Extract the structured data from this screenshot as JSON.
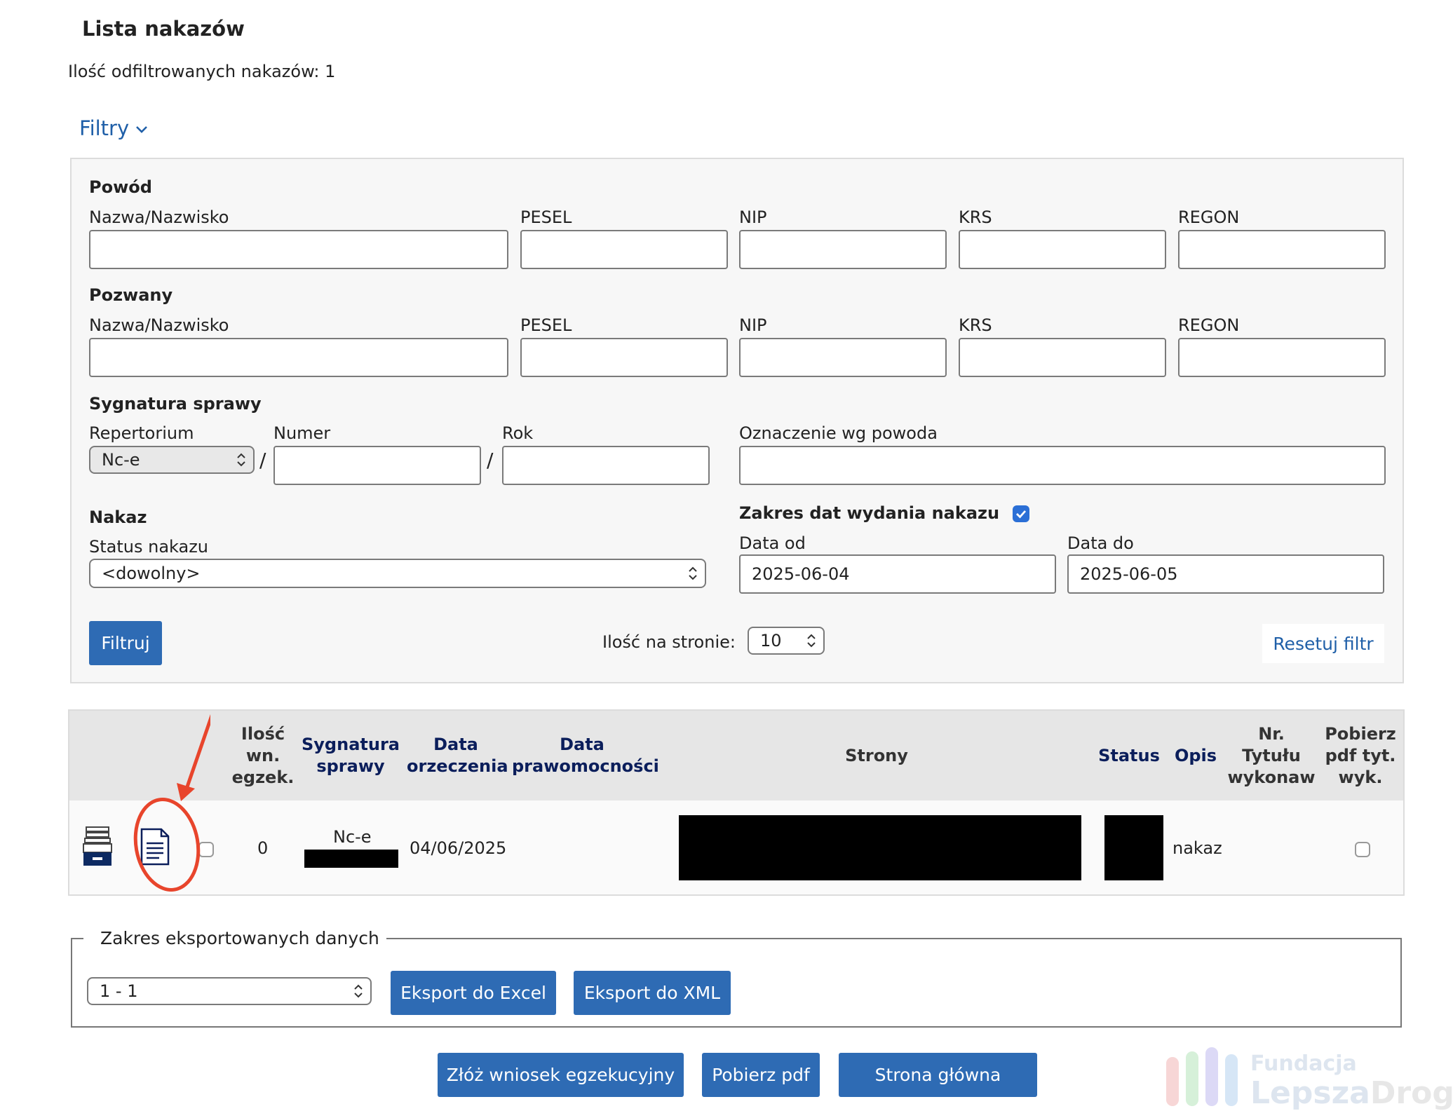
{
  "page": {
    "title": "Lista nakazów",
    "filtered_count": "Ilość odfiltrowanych nakazów: 1",
    "filters_toggle": "Filtry"
  },
  "filters": {
    "plaintiff": {
      "heading": "Powód",
      "labels": {
        "name": "Nazwa/Nazwisko",
        "pesel": "PESEL",
        "nip": "NIP",
        "krs": "KRS",
        "regon": "REGON"
      },
      "values": {
        "name": "",
        "pesel": "",
        "nip": "",
        "krs": "",
        "regon": ""
      }
    },
    "defendant": {
      "heading": "Pozwany",
      "labels": {
        "name": "Nazwa/Nazwisko",
        "pesel": "PESEL",
        "nip": "NIP",
        "krs": "KRS",
        "regon": "REGON"
      },
      "values": {
        "name": "",
        "pesel": "",
        "nip": "",
        "krs": "",
        "regon": ""
      }
    },
    "case_signature": {
      "heading": "Sygnatura sprawy",
      "repertorium_label": "Repertorium",
      "repertorium_value": "Nc-e",
      "number_label": "Numer",
      "number_value": "",
      "year_label": "Rok",
      "year_value": "",
      "separator": "/",
      "plaintiff_mark_label": "Oznaczenie wg powoda",
      "plaintiff_mark_value": ""
    },
    "order": {
      "heading": "Nakaz",
      "status_label": "Status nakazu",
      "status_value": "<dowolny>"
    },
    "date_range": {
      "heading": "Zakres dat wydania nakazu",
      "enabled": true,
      "from_label": "Data od",
      "from_value": "2025-06-04",
      "to_label": "Data do",
      "to_value": "2025-06-05"
    },
    "filter_button": "Filtruj",
    "per_page_label": "Ilość na stronie:",
    "per_page_value": "10",
    "reset_link": "Resetuj filtr"
  },
  "table": {
    "headers": {
      "enforcement_count": [
        "Ilość",
        "wn.",
        "egzek."
      ],
      "signature": [
        "Sygnatura",
        "sprawy"
      ],
      "ruling_date": [
        "Data",
        "orzeczenia"
      ],
      "finality_date": [
        "Data",
        "prawomocności"
      ],
      "parties": "Strony",
      "status": "Status",
      "description": "Opis",
      "title_number": [
        "Nr.",
        "Tytułu",
        "wykonaw"
      ],
      "download_pdf": [
        "Pobierz",
        "pdf tyt.",
        "wyk."
      ]
    },
    "rows": [
      {
        "enforcement_count": "0",
        "signature_prefix": "Nc-e",
        "ruling_date": "04/06/2025",
        "finality_date": "",
        "description": "nakaz",
        "title_number": ""
      }
    ],
    "icons": {
      "archive": "archive-cabinet-icon",
      "document": "document-icon"
    },
    "annotation_color": "#e8452c"
  },
  "export": {
    "legend": "Zakres eksportowanych danych",
    "range_value": "1 - 1",
    "excel_button": "Eksport do Excel",
    "xml_button": "Eksport do XML"
  },
  "actions": {
    "enforcement_request": "Złóż wniosek egzekucyjny",
    "download_pdf": "Pobierz pdf",
    "home": "Strona główna"
  },
  "watermark": {
    "line1": "Fundacja",
    "line2_a": "Lepsza",
    "line2_b": "Droga"
  },
  "colors": {
    "primary_button": "#2e6bb4",
    "link": "#1f5fa8",
    "header_navy": "#0b1e5b",
    "annotation": "#e8452c"
  }
}
